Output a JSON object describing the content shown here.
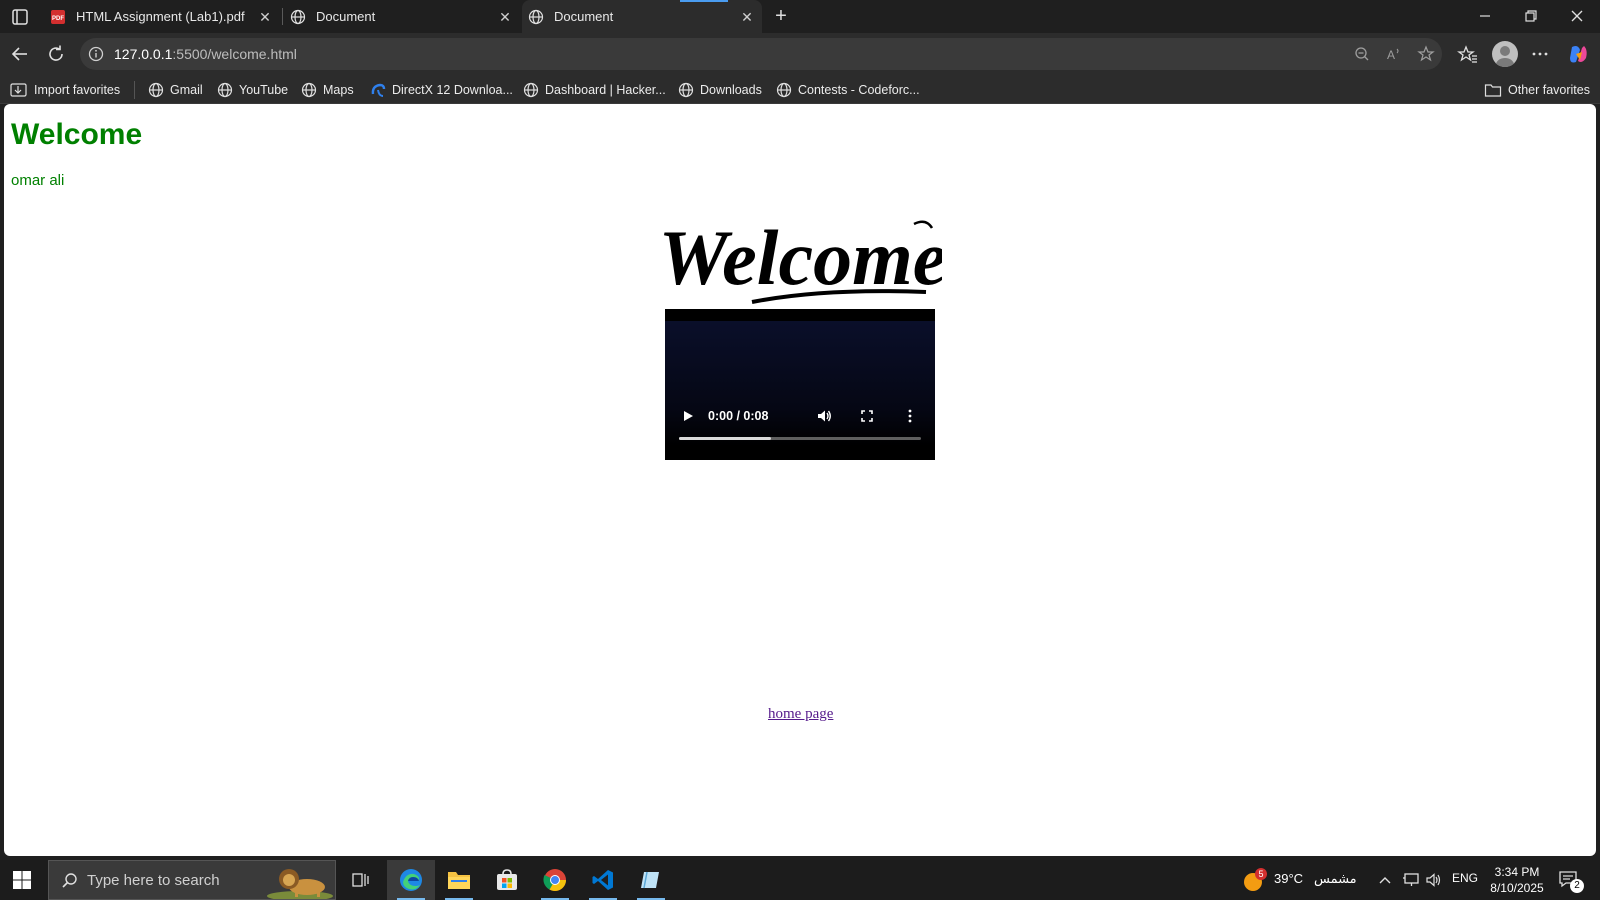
{
  "browser": {
    "tabs": [
      {
        "label": "HTML Assignment (Lab1).pdf",
        "icon": "pdf-icon",
        "active": false
      },
      {
        "label": "Document",
        "icon": "globe-icon",
        "active": false
      },
      {
        "label": "Document",
        "icon": "globe-icon",
        "active": true
      }
    ],
    "url_host": "127.0.0.1",
    "url_rest": ":5500/welcome.html"
  },
  "bookmarks": {
    "items": [
      {
        "label": "Import favorites",
        "icon": "import-icon"
      },
      {
        "label": "Gmail",
        "icon": "globe-icon"
      },
      {
        "label": "YouTube",
        "icon": "globe-icon"
      },
      {
        "label": "Maps",
        "icon": "globe-icon"
      },
      {
        "label": "DirectX 12 Downloa...",
        "icon": "directx-icon"
      },
      {
        "label": "Dashboard | Hacker...",
        "icon": "globe-icon"
      },
      {
        "label": "Downloads",
        "icon": "globe-icon"
      },
      {
        "label": "Contests - Codeforc...",
        "icon": "globe-icon"
      }
    ],
    "other": "Other favorites"
  },
  "page": {
    "title": "Welcome",
    "subtitle": "omar ali",
    "welcome_image_text": "Welcome",
    "video": {
      "time": "0:00 / 0:08",
      "buffered_fraction": 0.38
    },
    "home_link": "home page"
  },
  "taskbar": {
    "search_placeholder": "Type here to search",
    "weather_temp": "39°C",
    "weather_label": "مشمس",
    "weather_badge": "5",
    "language": "ENG",
    "time": "3:34 PM",
    "date": "8/10/2025",
    "notification_count": "2"
  },
  "colors": {
    "accent": "#4a9cf0",
    "heading_green": "#008000",
    "visited_link": "#551a8b"
  }
}
